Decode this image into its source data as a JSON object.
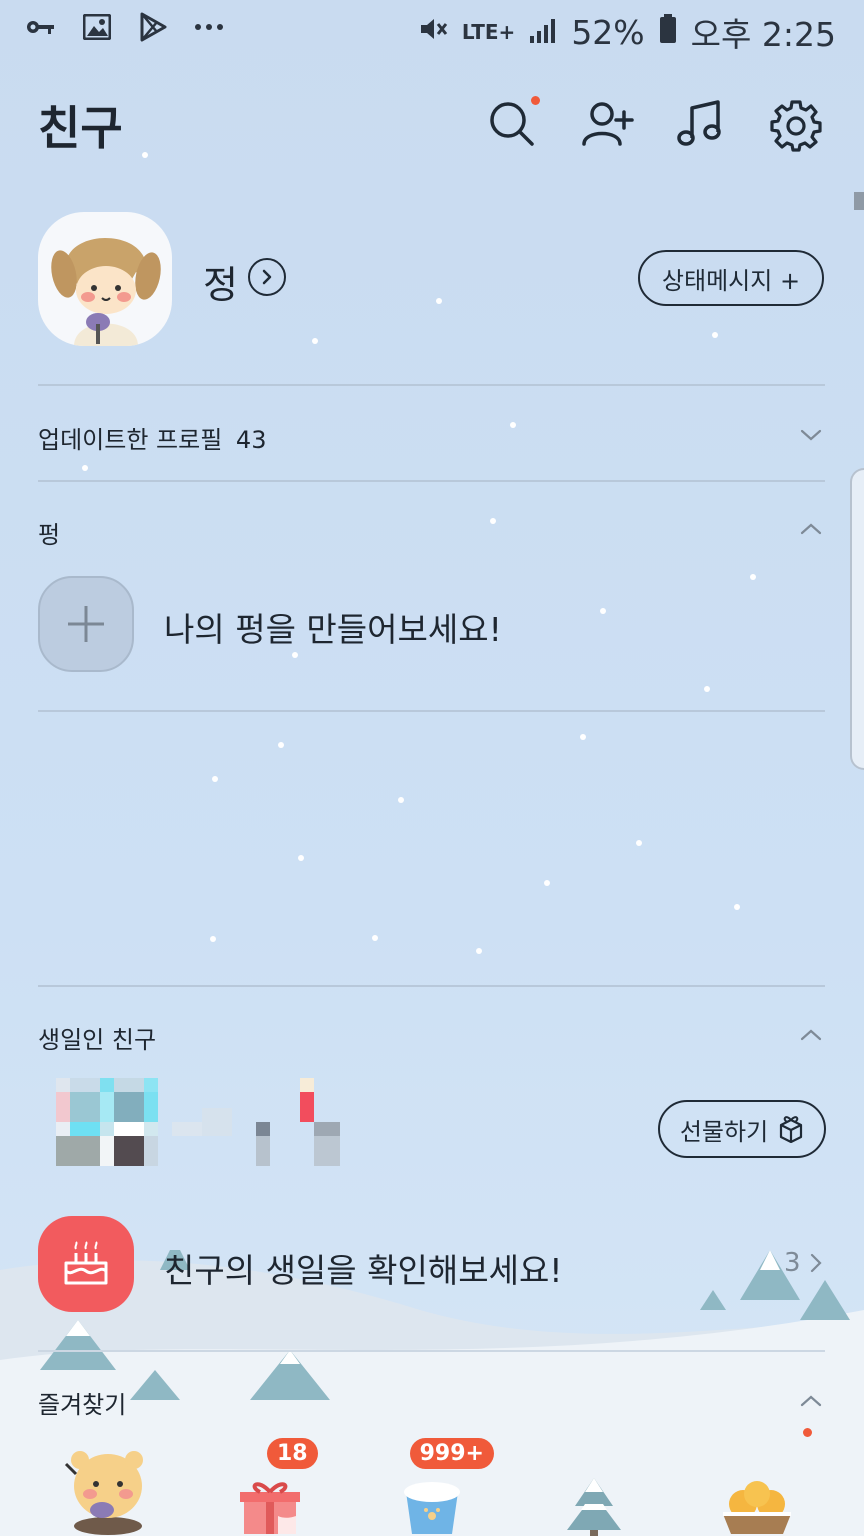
{
  "status_bar": {
    "battery": "52%",
    "network": "LTE+",
    "time": "오후 2:25",
    "left_icons": [
      "key-icon",
      "image-icon",
      "play-store-icon",
      "more-icon"
    ]
  },
  "header": {
    "title": "친구"
  },
  "profile": {
    "name": "정",
    "status_button": "상태메시지 +"
  },
  "updated_profiles": {
    "label": "업데이트한 프로필",
    "count": "43"
  },
  "pyeong": {
    "label": "펑",
    "add_text": "나의 펑을 만들어보세요!"
  },
  "birthday": {
    "label": "생일인 친구",
    "gift_button": "선물하기",
    "prompt": "친구의 생일을 확인해보세요!",
    "count": "3"
  },
  "favorites": {
    "label": "즐겨찾기",
    "items": [
      {
        "name": "profile-character"
      },
      {
        "name": "gift",
        "badge": "18"
      },
      {
        "name": "bucket",
        "badge": "999+"
      },
      {
        "name": "tree"
      },
      {
        "name": "oranges"
      }
    ]
  },
  "colors": {
    "accent_red": "#f05a3a",
    "cake_tile": "#f25b5e",
    "background": "#cde0f4"
  }
}
